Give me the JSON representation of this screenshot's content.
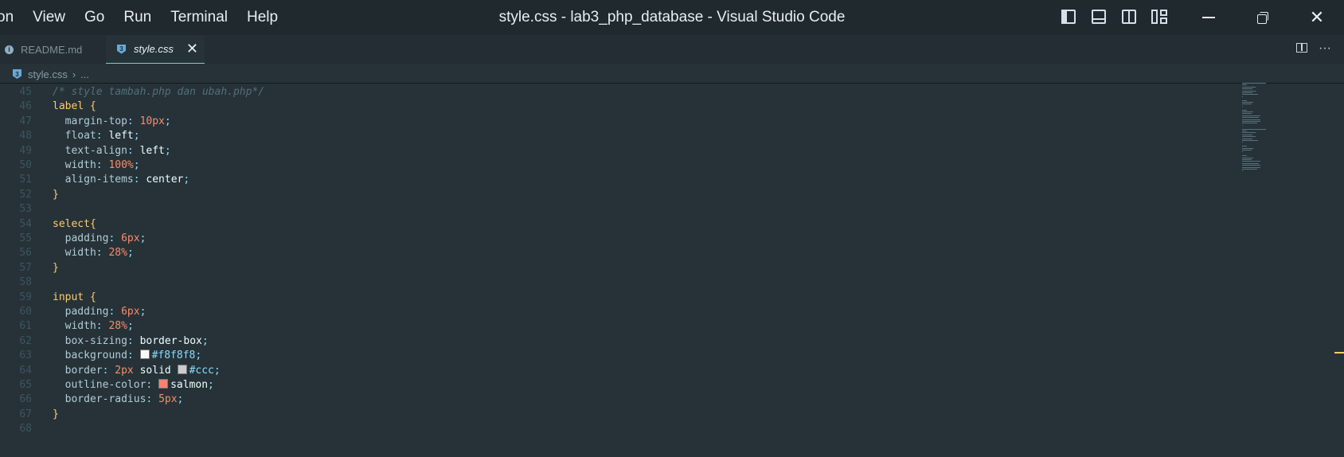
{
  "titlebar": {
    "menu": [
      "on",
      "View",
      "Go",
      "Run",
      "Terminal",
      "Help"
    ],
    "title": "style.css - lab3_php_database - Visual Studio Code"
  },
  "tabs": [
    {
      "label": "README.md",
      "icon": "info-icon",
      "active": false
    },
    {
      "label": "style.css",
      "icon": "css-icon",
      "active": true
    }
  ],
  "breadcrumb": {
    "file": "style.css",
    "ellipsis": "..."
  },
  "editor": {
    "lines": [
      {
        "n": "45",
        "tokens": [
          {
            "t": "/* style tambah.php dan ubah.php*/",
            "c": "c-comment"
          }
        ]
      },
      {
        "n": "46",
        "tokens": [
          {
            "t": "label ",
            "c": "c-sel"
          },
          {
            "t": "{",
            "c": "c-sel"
          }
        ]
      },
      {
        "n": "47",
        "tokens": [
          {
            "t": "  margin-top",
            "c": "c-prop"
          },
          {
            "t": ": ",
            "c": "c-punc"
          },
          {
            "t": "10px",
            "c": "c-num"
          },
          {
            "t": ";",
            "c": "c-punc"
          }
        ]
      },
      {
        "n": "48",
        "tokens": [
          {
            "t": "  float",
            "c": "c-prop"
          },
          {
            "t": ": ",
            "c": "c-punc"
          },
          {
            "t": "left",
            "c": "c-val"
          },
          {
            "t": ";",
            "c": "c-punc"
          }
        ]
      },
      {
        "n": "49",
        "tokens": [
          {
            "t": "  text-align",
            "c": "c-prop"
          },
          {
            "t": ": ",
            "c": "c-punc"
          },
          {
            "t": "left",
            "c": "c-val"
          },
          {
            "t": ";",
            "c": "c-punc"
          }
        ]
      },
      {
        "n": "50",
        "tokens": [
          {
            "t": "  width",
            "c": "c-prop"
          },
          {
            "t": ": ",
            "c": "c-punc"
          },
          {
            "t": "100%",
            "c": "c-num"
          },
          {
            "t": ";",
            "c": "c-punc"
          }
        ]
      },
      {
        "n": "51",
        "tokens": [
          {
            "t": "  align-items",
            "c": "c-prop"
          },
          {
            "t": ": ",
            "c": "c-punc"
          },
          {
            "t": "center",
            "c": "c-val"
          },
          {
            "t": ";",
            "c": "c-punc"
          }
        ]
      },
      {
        "n": "52",
        "tokens": [
          {
            "t": "}",
            "c": "c-sel"
          }
        ]
      },
      {
        "n": "53",
        "tokens": []
      },
      {
        "n": "54",
        "tokens": [
          {
            "t": "select",
            "c": "c-sel"
          },
          {
            "t": "{",
            "c": "c-sel"
          }
        ]
      },
      {
        "n": "55",
        "tokens": [
          {
            "t": "  padding",
            "c": "c-prop"
          },
          {
            "t": ": ",
            "c": "c-punc"
          },
          {
            "t": "6px",
            "c": "c-num"
          },
          {
            "t": ";",
            "c": "c-punc"
          }
        ]
      },
      {
        "n": "56",
        "tokens": [
          {
            "t": "  width",
            "c": "c-prop"
          },
          {
            "t": ": ",
            "c": "c-punc"
          },
          {
            "t": "28%",
            "c": "c-num"
          },
          {
            "t": ";",
            "c": "c-punc"
          }
        ]
      },
      {
        "n": "57",
        "tokens": [
          {
            "t": "}",
            "c": "c-sel"
          }
        ]
      },
      {
        "n": "58",
        "tokens": []
      },
      {
        "n": "59",
        "tokens": [
          {
            "t": "input ",
            "c": "c-sel"
          },
          {
            "t": "{",
            "c": "c-sel"
          }
        ]
      },
      {
        "n": "60",
        "tokens": [
          {
            "t": "  padding",
            "c": "c-prop"
          },
          {
            "t": ": ",
            "c": "c-punc"
          },
          {
            "t": "6px",
            "c": "c-num"
          },
          {
            "t": ";",
            "c": "c-punc"
          }
        ]
      },
      {
        "n": "61",
        "tokens": [
          {
            "t": "  width",
            "c": "c-prop"
          },
          {
            "t": ": ",
            "c": "c-punc"
          },
          {
            "t": "28%",
            "c": "c-num"
          },
          {
            "t": ";",
            "c": "c-punc"
          }
        ]
      },
      {
        "n": "62",
        "tokens": [
          {
            "t": "  box-sizing",
            "c": "c-prop"
          },
          {
            "t": ": ",
            "c": "c-punc"
          },
          {
            "t": "border-box",
            "c": "c-val"
          },
          {
            "t": ";",
            "c": "c-punc"
          }
        ]
      },
      {
        "n": "63",
        "tokens": [
          {
            "t": "  background",
            "c": "c-prop"
          },
          {
            "t": ": ",
            "c": "c-punc"
          },
          {
            "swatch": "#f8f8f8"
          },
          {
            "t": "#f8f8f8",
            "c": "c-hex"
          },
          {
            "t": ";",
            "c": "c-punc"
          }
        ]
      },
      {
        "n": "64",
        "tokens": [
          {
            "t": "  border",
            "c": "c-prop"
          },
          {
            "t": ": ",
            "c": "c-punc"
          },
          {
            "t": "2px",
            "c": "c-num"
          },
          {
            "t": " solid ",
            "c": "c-val"
          },
          {
            "swatch": "#cccccc"
          },
          {
            "t": "#ccc",
            "c": "c-hex"
          },
          {
            "t": ";",
            "c": "c-punc"
          }
        ]
      },
      {
        "n": "65",
        "tokens": [
          {
            "t": "  outline-color",
            "c": "c-prop"
          },
          {
            "t": ": ",
            "c": "c-punc"
          },
          {
            "swatch": "#fa8072"
          },
          {
            "t": "salmon",
            "c": "c-val"
          },
          {
            "t": ";",
            "c": "c-punc"
          }
        ]
      },
      {
        "n": "66",
        "tokens": [
          {
            "t": "  border-radius",
            "c": "c-prop"
          },
          {
            "t": ": ",
            "c": "c-punc"
          },
          {
            "t": "5px",
            "c": "c-num"
          },
          {
            "t": ";",
            "c": "c-punc"
          }
        ]
      },
      {
        "n": "67",
        "tokens": [
          {
            "t": "}",
            "c": "c-sel"
          }
        ]
      },
      {
        "n": "68",
        "tokens": []
      }
    ]
  },
  "colors": {
    "accent": "#80cbc4",
    "selector": "#ffcb6b",
    "number": "#f78c6c",
    "comment": "#546e7a"
  }
}
